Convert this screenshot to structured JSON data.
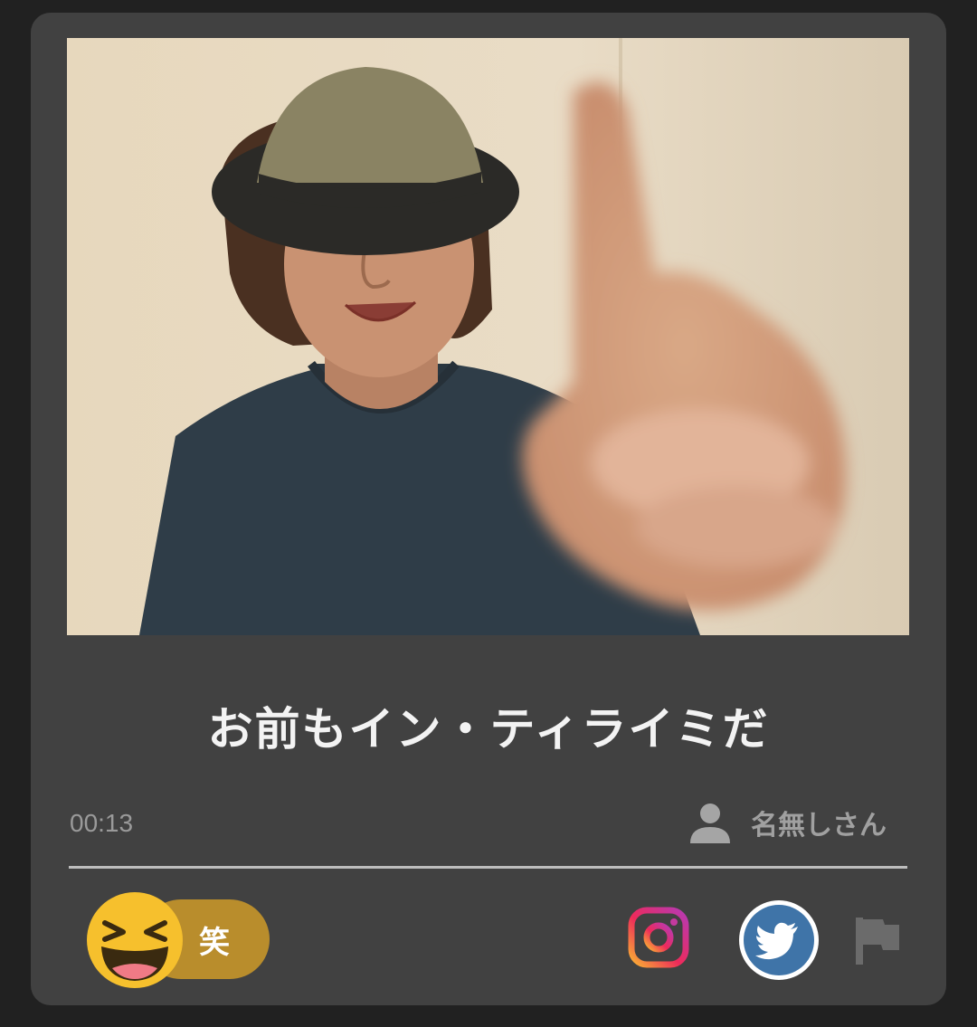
{
  "post": {
    "caption": "お前もイン・ティライミだ",
    "time": "00:13",
    "author": "名無しさん"
  },
  "reaction": {
    "label": "笑"
  },
  "icons": {
    "user": "user-icon",
    "laughing": "laughing-emoji-icon",
    "instagram": "instagram-icon",
    "twitter": "twitter-icon",
    "flag": "flag-icon"
  },
  "colors": {
    "background": "#212121",
    "card": "#414141",
    "reaction_pill": "#b98d2c",
    "emoji_yellow": "#f6c02d",
    "twitter_blue": "#3f74a8"
  }
}
